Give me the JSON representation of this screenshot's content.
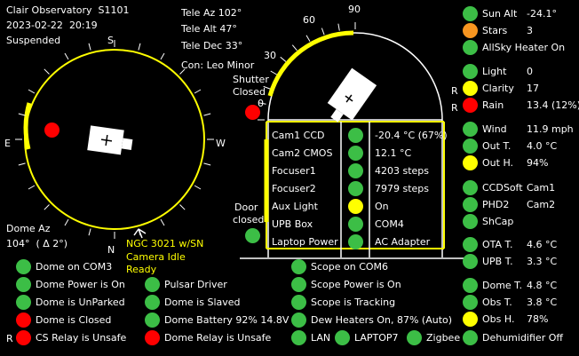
{
  "observatory": {
    "name": "Clair Observatory",
    "station": "S1101",
    "date": "2023-02-22",
    "time": "20:19",
    "state": "Suspended"
  },
  "telescope": {
    "tele_az": "Tele Az 102°",
    "tele_alt": "Tele Alt 47°",
    "tele_dec": "Tele Dec 33°",
    "constellation": "Con: Leo Minor"
  },
  "compass": {
    "n": "N",
    "s": "S",
    "e": "E",
    "w": "W"
  },
  "dome": {
    "az_label": "Dome Az",
    "az_value": "104°",
    "az_delta": "( Δ 2°)",
    "target": "NGC 3021 w/SN",
    "camera_status": "Camera Idle",
    "ready": "Ready"
  },
  "altitude_scale": {
    "t0": "0",
    "t30": "30",
    "t60": "60",
    "t90": "90"
  },
  "shutter": {
    "line1": "Shutter",
    "line2": "Closed"
  },
  "door": {
    "line1": "Door",
    "line2": "closed"
  },
  "equipment": [
    {
      "name": "Cam1 CCD",
      "value": "-20.4 °C (67%)",
      "status": "green"
    },
    {
      "name": "Cam2 CMOS",
      "value": "12.1 °C",
      "status": "green"
    },
    {
      "name": "Focuser1",
      "value": "4203 steps",
      "status": "green"
    },
    {
      "name": "Focuser2",
      "value": "7979 steps",
      "status": "green"
    },
    {
      "name": "Aux Light",
      "value": "On",
      "status": "yellow"
    },
    {
      "name": "UPB Box",
      "value": "COM4",
      "status": "green"
    },
    {
      "name": "Laptop Power",
      "value": "AC Adapter",
      "status": "green"
    }
  ],
  "status_left": [
    {
      "label": "Dome on COM3",
      "status": "green",
      "prefix": ""
    },
    {
      "label": "Dome Power is On",
      "status": "green",
      "prefix": ""
    },
    {
      "label": "Dome is UnParked",
      "status": "green",
      "prefix": ""
    },
    {
      "label": "Dome is Closed",
      "status": "red",
      "prefix": ""
    },
    {
      "label": "CS Relay is Unsafe",
      "status": "red",
      "prefix": "R"
    }
  ],
  "status_mid": [
    {
      "label": "Pulsar Driver",
      "status": "green"
    },
    {
      "label": "Dome is Slaved",
      "status": "green"
    },
    {
      "label": "Dome Battery 92%  14.8V",
      "status": "green"
    },
    {
      "label": "Dome Relay is Unsafe",
      "status": "red"
    }
  ],
  "status_scope": [
    {
      "label": "Scope on COM6",
      "status": "green"
    },
    {
      "label": "Scope Power is On",
      "status": "green"
    },
    {
      "label": "Scope is Tracking",
      "status": "green"
    },
    {
      "label": "Dew Heaters On, 87% (Auto)",
      "status": "green"
    }
  ],
  "network": {
    "lan": "LAN",
    "laptop": "LAPTOP7",
    "zigbee": "Zigbee"
  },
  "weather_top": [
    {
      "label": "Sun Alt",
      "value": "-24.1°",
      "status": "green",
      "prefix": ""
    },
    {
      "label": "Stars",
      "value": "3",
      "status": "orange",
      "prefix": ""
    },
    {
      "label": "AllSky Heater  On",
      "value": "",
      "status": "green",
      "prefix": ""
    }
  ],
  "weather_sky": [
    {
      "label": "Light",
      "value": "0",
      "status": "green",
      "prefix": ""
    },
    {
      "label": "Clarity",
      "value": "17",
      "status": "yellow",
      "prefix": "R"
    },
    {
      "label": "Rain",
      "value": "13.4  (12%)",
      "status": "red",
      "prefix": "R"
    }
  ],
  "weather_env": [
    {
      "label": "Wind",
      "value": "11.9 mph",
      "status": "green"
    },
    {
      "label": "Out T.",
      "value": "4.0 °C",
      "status": "green"
    },
    {
      "label": "Out H.",
      "value": "94%",
      "status": "yellow"
    }
  ],
  "software": [
    {
      "label": "CCDSoft",
      "value": "Cam1",
      "status": "green"
    },
    {
      "label": "PHD2",
      "value": "Cam2",
      "status": "green"
    },
    {
      "label": "ShCap",
      "value": "",
      "status": "green"
    }
  ],
  "temps1": [
    {
      "label": "OTA T.",
      "value": "4.6 °C",
      "status": "green"
    },
    {
      "label": "UPB T.",
      "value": "3.3 °C",
      "status": "green"
    }
  ],
  "temps2": [
    {
      "label": "Dome T.",
      "value": "4.8 °C",
      "status": "green"
    },
    {
      "label": "Obs T.",
      "value": "3.8 °C",
      "status": "green"
    },
    {
      "label": "Obs H.",
      "value": "78%",
      "status": "yellow"
    }
  ],
  "dehumidifier": {
    "label": "Dehumidifier Off",
    "status": "green"
  },
  "colors": {
    "green": "#3cbe46",
    "red": "#ff0000",
    "yellow": "#ffff00",
    "orange": "#f79520"
  }
}
